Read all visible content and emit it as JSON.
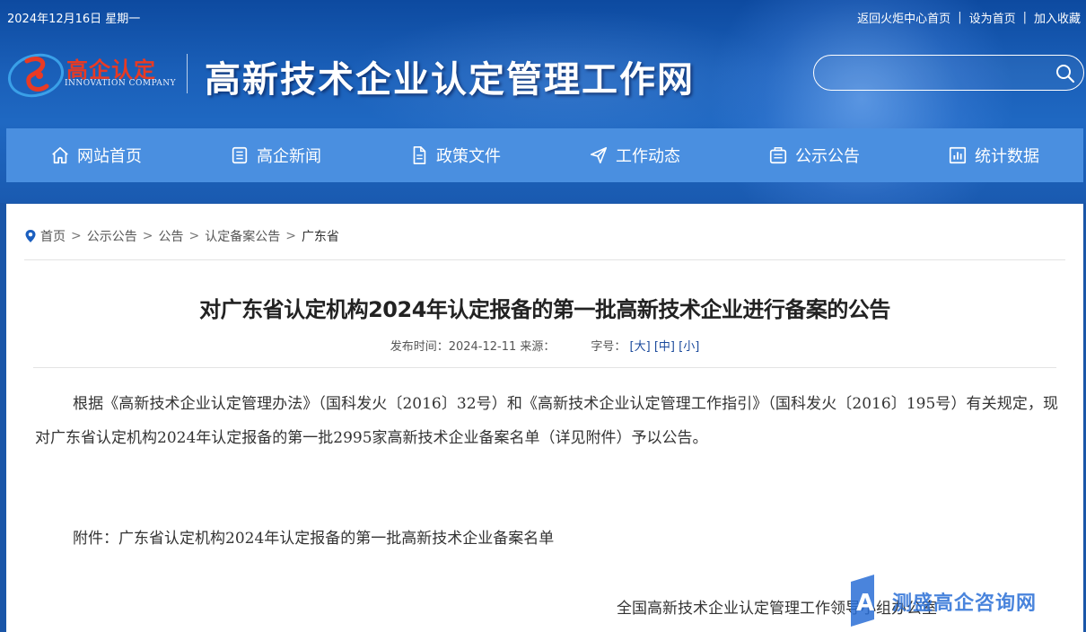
{
  "topbar": {
    "date": "2024年12月16日 星期一",
    "links": [
      "返回火炬中心首页",
      "设为首页",
      "加入收藏"
    ],
    "separator": "|"
  },
  "logo": {
    "cn": "高企认定",
    "en": "INNOVATION COMPANY"
  },
  "site_title": "高新技术企业认定管理工作网",
  "search": {
    "value": "",
    "icon": "search-icon"
  },
  "nav": [
    {
      "label": "网站首页",
      "icon": "home-icon"
    },
    {
      "label": "高企新闻",
      "icon": "news-icon"
    },
    {
      "label": "政策文件",
      "icon": "document-icon"
    },
    {
      "label": "工作动态",
      "icon": "paper-plane-icon"
    },
    {
      "label": "公示公告",
      "icon": "bulletin-icon"
    },
    {
      "label": "统计数据",
      "icon": "chart-icon"
    }
  ],
  "breadcrumb": {
    "items": [
      "首页",
      "公示公告",
      "公告",
      "认定备案公告",
      "广东省"
    ],
    "separator": ">"
  },
  "article": {
    "title": "对广东省认定机构2024年认定报备的第一批高新技术企业进行备案的公告",
    "meta_publish": "发布时间：2024-12-11 来源：",
    "meta_font_label": "字号：",
    "font_sizes": [
      "[大]",
      "[中]",
      "[小]"
    ],
    "body": "根据《高新技术企业认定管理办法》（国科发火〔2016〕32号）和《高新技术企业认定管理工作指引》（国科发火〔2016〕195号）有关规定，现对广东省认定机构2024年认定报备的第一批2995家高新技术企业备案名单（详见附件）予以公告。",
    "attachment": "附件：广东省认定机构2024年认定报备的第一批高新技术企业备案名单",
    "signature": "全国高新技术企业认定管理工作领导小组办公室"
  },
  "watermark": {
    "text": "测盛高企咨询网"
  },
  "colors": {
    "header_bg": "#1a5fb8",
    "nav_bg": "#4a8fe0",
    "logo_red": "#e83a24",
    "link_blue": "#1b4a9c"
  }
}
